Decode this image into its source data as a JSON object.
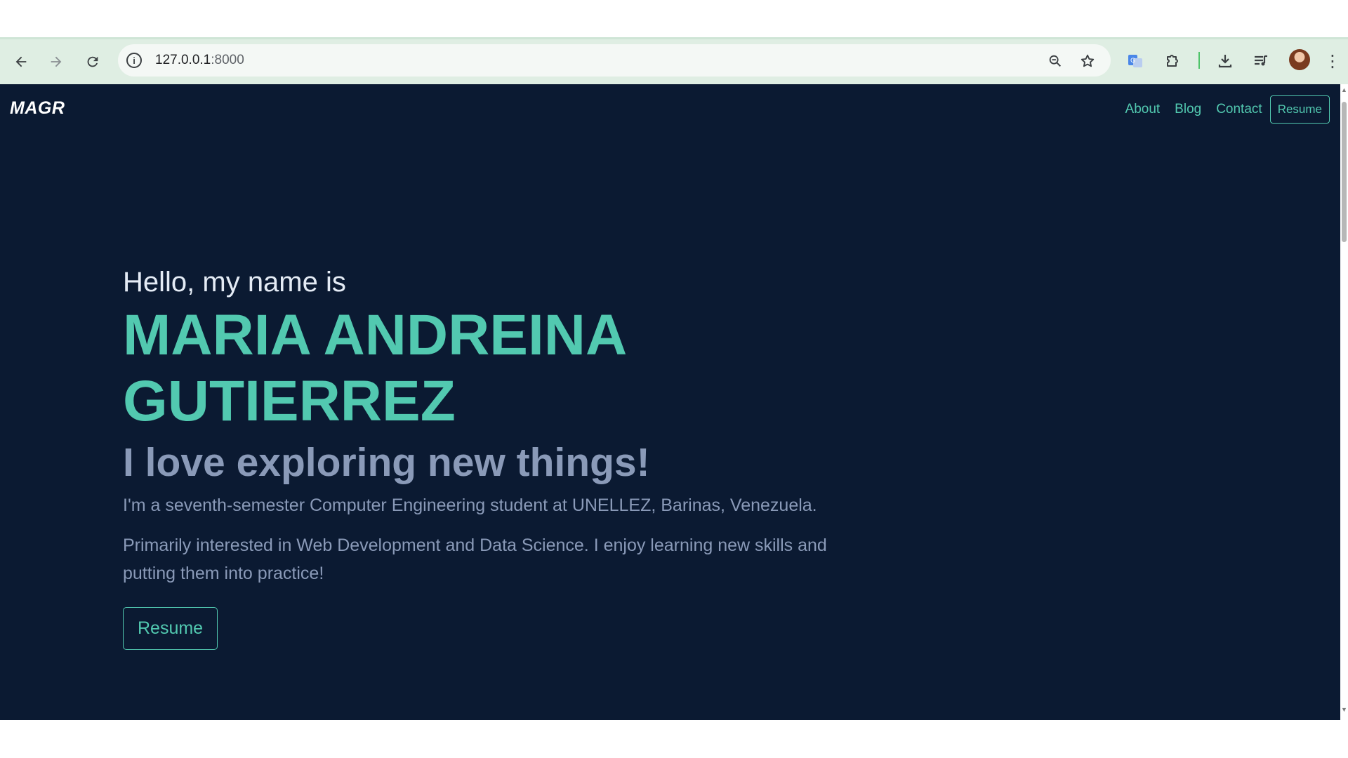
{
  "browser": {
    "url_host": "127.0.0.1",
    "url_port": ":8000",
    "icons": {
      "back": "arrow-left-icon",
      "forward": "arrow-right-icon",
      "reload": "reload-icon",
      "site_info": "info-icon",
      "zoom": "zoom-icon",
      "bookmark": "star-icon",
      "translate": "translate-icon",
      "extensions": "puzzle-icon",
      "downloads": "download-icon",
      "media": "media-queue-icon",
      "menu": "kebab-menu-icon"
    }
  },
  "site": {
    "logo": "MAGR",
    "nav": {
      "about": "About",
      "blog": "Blog",
      "contact": "Contact",
      "resume": "Resume"
    }
  },
  "hero": {
    "greeting": "Hello, my name is",
    "name_line1": "MARIA ANDREINA",
    "name_line2": "GUTIERREZ",
    "tagline": "I love exploring new things!",
    "bio1": "I'm a seventh-semester Computer Engineering student at UNELLEZ, Barinas, Venezuela.",
    "bio2": "Primarily interested in Web Development and Data Science. I enjoy learning new skills and putting them into practice!",
    "resume_button": "Resume"
  },
  "colors": {
    "page_bg": "#0b1a32",
    "accent": "#52c9b0",
    "muted_text": "#8a9ab8",
    "chrome_bg": "#dfeee3"
  }
}
